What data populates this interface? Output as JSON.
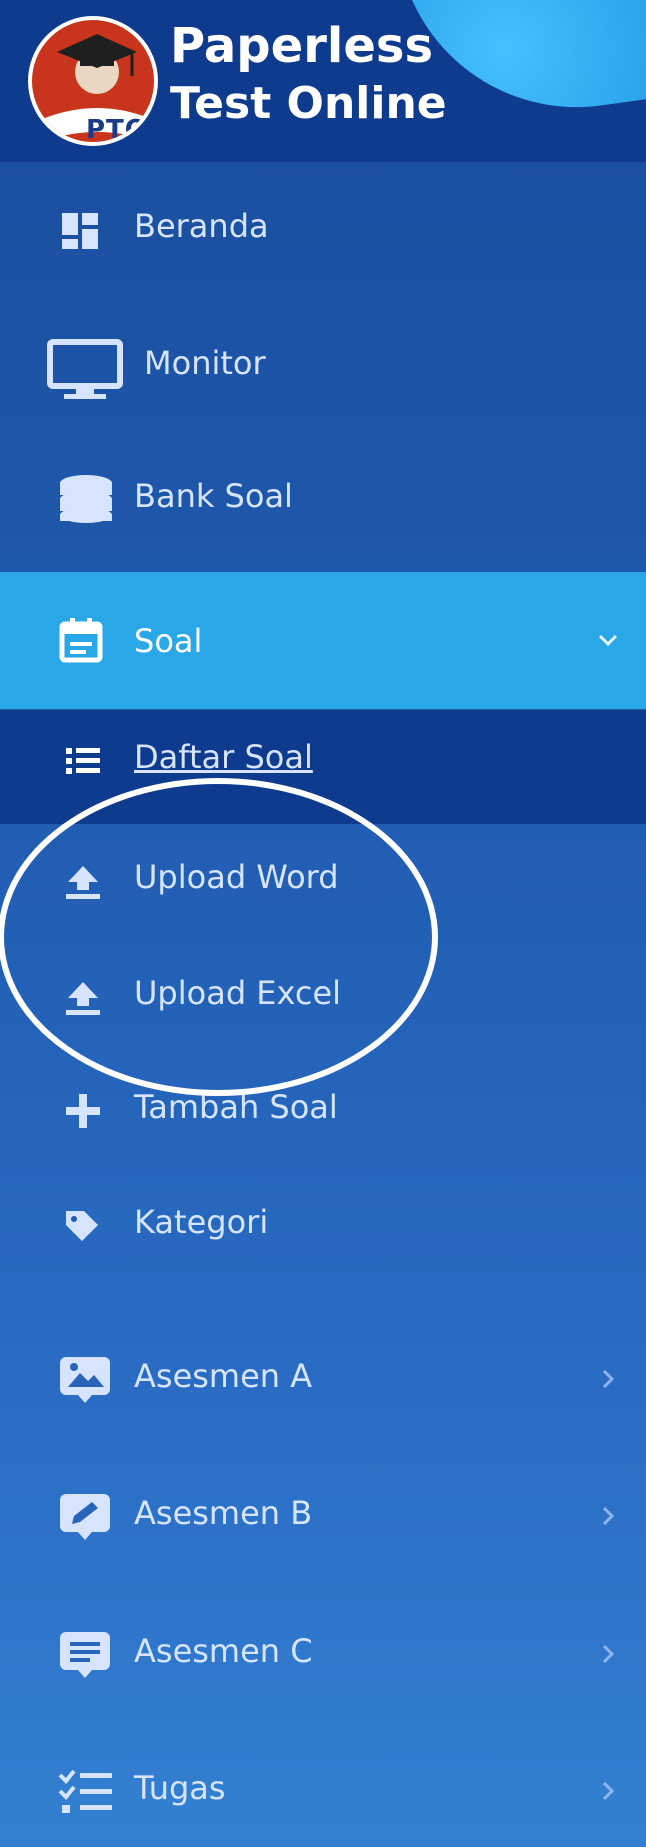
{
  "brand": {
    "line1": "Paperless",
    "line2": "Test Online",
    "logo_abbrev": "PTO"
  },
  "menu": {
    "beranda": "Beranda",
    "monitor": "Monitor",
    "bank_soal": "Bank Soal",
    "soal": "Soal",
    "asesmen_a": "Asesmen A",
    "asesmen_b": "Asesmen B",
    "asesmen_c": "Asesmen C",
    "tugas": "Tugas"
  },
  "submenu": {
    "daftar_soal": "Daftar Soal",
    "upload_word": "Upload Word",
    "upload_excel": "Upload Excel",
    "tambah_soal": "Tambah Soal",
    "kategori": "Kategori"
  },
  "colors": {
    "header": "#0f3b8f",
    "active_item": "#2aa7e6",
    "text": "#d6e4ff"
  }
}
